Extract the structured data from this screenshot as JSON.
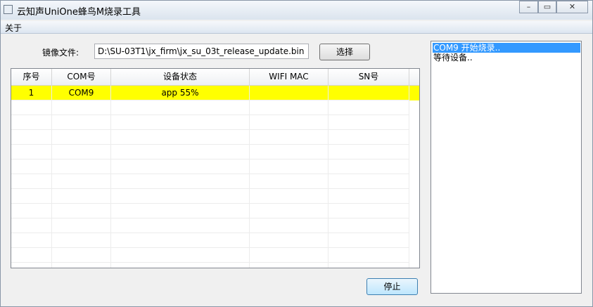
{
  "window": {
    "title": "云知声UniOne蜂鸟M烧录工具"
  },
  "titlebar": {
    "minimize": "–",
    "maximize": "▭",
    "close": "✕"
  },
  "menu": {
    "items": [
      "关于"
    ]
  },
  "file": {
    "label": "镜像文件:",
    "path": "D:\\SU-03T1\\jx_firm\\jx_su_03t_release_update.bin",
    "select_button": "选择"
  },
  "table": {
    "headers": [
      "序号",
      "COM号",
      "设备状态",
      "WIFI MAC",
      "SN号"
    ],
    "rows": [
      {
        "index": "1",
        "com": "COM9",
        "status": "app 55%",
        "mac": "",
        "sn": "",
        "highlight_color": "#ffff00"
      }
    ],
    "empty_rows": 12
  },
  "log": {
    "lines": [
      "COM9 开始烧录..",
      "等待设备.."
    ],
    "selected_index": 0
  },
  "stop_button": "停止"
}
